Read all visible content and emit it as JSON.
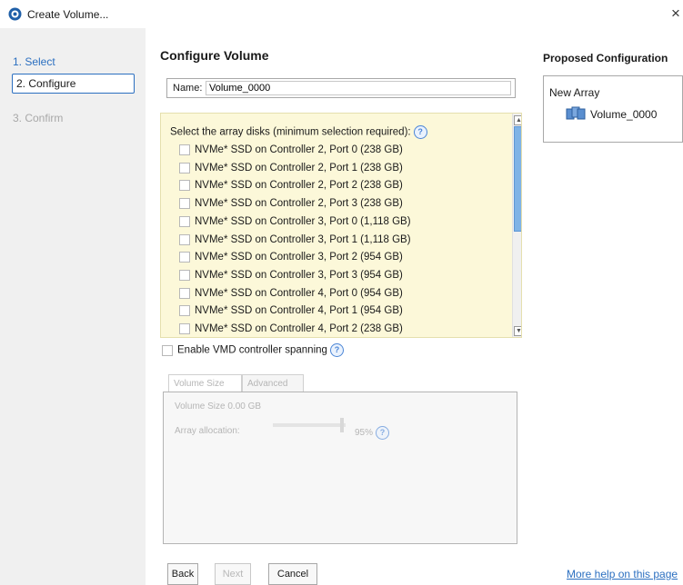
{
  "window": {
    "title": "Create Volume...",
    "close_label": "×"
  },
  "sidebar": {
    "steps": [
      {
        "label": "1. Select"
      },
      {
        "label": "2. Configure"
      },
      {
        "label": "3. Confirm"
      }
    ]
  },
  "main": {
    "heading": "Configure Volume",
    "name_label": "Name:",
    "name_value": "Volume_0000",
    "disks_title": "Select the array disks (minimum selection required):",
    "disks": [
      "NVMe* SSD on Controller 2, Port 0 (238 GB)",
      "NVMe* SSD on Controller 2, Port 1 (238 GB)",
      "NVMe* SSD on Controller 2, Port 2 (238 GB)",
      "NVMe* SSD on Controller 2, Port 3 (238 GB)",
      "NVMe* SSD on Controller 3, Port 0 (1,118 GB)",
      "NVMe* SSD on Controller 3, Port 1 (1,118 GB)",
      "NVMe* SSD on Controller 3, Port 2 (954 GB)",
      "NVMe* SSD on Controller 3, Port 3 (954 GB)",
      "NVMe* SSD on Controller 4, Port 0 (954 GB)",
      "NVMe* SSD on Controller 4, Port 1 (954 GB)",
      "NVMe* SSD on Controller 4, Port 2 (238 GB)"
    ],
    "vmd_label": "Enable VMD controller spanning",
    "tabs": [
      {
        "label": "Volume Size"
      },
      {
        "label": "Advanced"
      }
    ],
    "volume_size": "Volume Size 0.00 GB",
    "array_allocation_label": "Array allocation:",
    "array_allocation_value": "95%",
    "array_allocation_fraction": 0.95
  },
  "footer": {
    "back": "Back",
    "next": "Next",
    "cancel": "Cancel",
    "help_link": "More help on this page"
  },
  "proposed": {
    "title": "Proposed Configuration",
    "array_label": "New Array",
    "volume_label": "Volume_0000"
  },
  "colors": {
    "accent": "#2b6fc0",
    "disk_panel_bg": "#fcf8d9",
    "sidebar_bg": "#f0f0f0"
  },
  "icons": {
    "app": "intel-rst-icon",
    "help": "help-icon",
    "volume": "volume-disks-icon"
  }
}
